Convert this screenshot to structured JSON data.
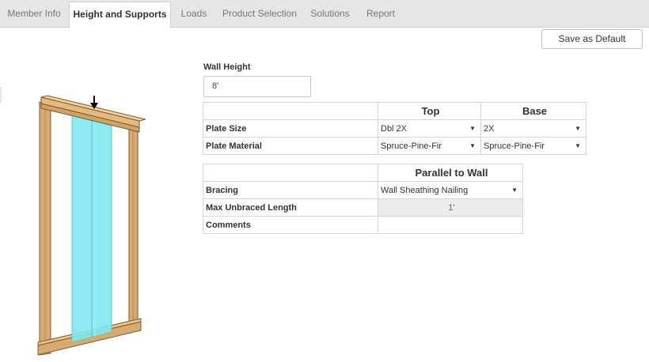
{
  "tabs": [
    {
      "label": "Member Info",
      "active": false
    },
    {
      "label": "Height and Supports",
      "active": true
    },
    {
      "label": "Loads",
      "active": false
    },
    {
      "label": "Product Selection",
      "active": false
    },
    {
      "label": "Solutions",
      "active": false
    },
    {
      "label": "Report",
      "active": false
    }
  ],
  "toolbar": {
    "save_default_label": "Save as Default"
  },
  "wall_height": {
    "label": "Wall Height",
    "value": "8'"
  },
  "plates_table": {
    "columns": [
      "Top",
      "Base"
    ],
    "rows": [
      {
        "label": "Plate Size",
        "top": "Dbl 2X",
        "base": "2X"
      },
      {
        "label": "Plate Material",
        "top": "Spruce-Pine-Fir",
        "base": "Spruce-Pine-Fir"
      }
    ]
  },
  "bracing_table": {
    "column": "Parallel to Wall",
    "rows": [
      {
        "label": "Bracing",
        "value": "Wall Sheathing Nailing"
      },
      {
        "label": "Max Unbraced Length",
        "value": "1'"
      },
      {
        "label": "Comments",
        "value": ""
      }
    ]
  },
  "illustration": {
    "name": "wall-frame",
    "sheathing_color": "#7fe8ee",
    "lumber_color": "#d4a86a"
  },
  "icons": {
    "dropdown": "caret-down-icon",
    "load_arrow": "arrow-down-icon"
  }
}
